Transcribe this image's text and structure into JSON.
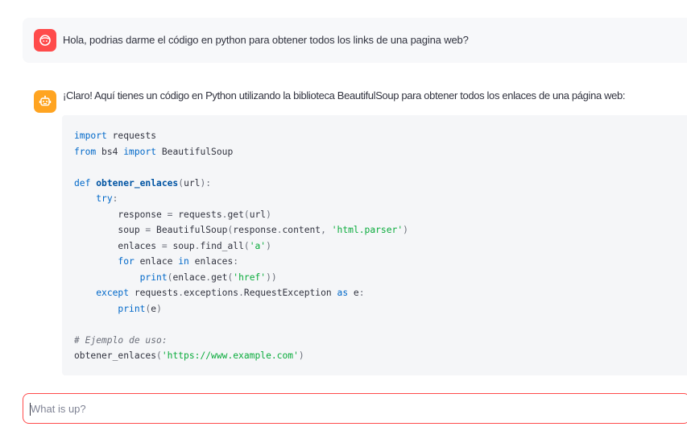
{
  "messages": [
    {
      "role": "user",
      "avatar_icon": "user-face-icon",
      "avatar_color": "#ff4b4b",
      "text": "Hola, podrias darme el código en python para obtener todos los links de una pagina web?"
    },
    {
      "role": "assistant",
      "avatar_icon": "robot-icon",
      "avatar_color": "#ffa421",
      "text": "¡Claro! Aquí tienes un código en Python utilizando la biblioteca BeautifulSoup para obtener todos los enlaces de una página web:",
      "code": {
        "language": "python",
        "lines": [
          [
            {
              "t": "import",
              "c": "kw"
            },
            {
              "t": " requests"
            }
          ],
          [
            {
              "t": "from",
              "c": "kw"
            },
            {
              "t": " bs4 "
            },
            {
              "t": "import",
              "c": "kw"
            },
            {
              "t": " BeautifulSoup"
            }
          ],
          [],
          [
            {
              "t": "def ",
              "c": "kw"
            },
            {
              "t": "obtener_enlaces",
              "c": "fn"
            },
            {
              "t": "(",
              "c": "op"
            },
            {
              "t": "url"
            },
            {
              "t": "):",
              "c": "op"
            }
          ],
          [
            {
              "t": "    "
            },
            {
              "t": "try",
              "c": "kw"
            },
            {
              "t": ":",
              "c": "op"
            }
          ],
          [
            {
              "t": "        response "
            },
            {
              "t": "=",
              "c": "op"
            },
            {
              "t": " requests"
            },
            {
              "t": ".",
              "c": "op"
            },
            {
              "t": "get"
            },
            {
              "t": "(",
              "c": "op"
            },
            {
              "t": "url"
            },
            {
              "t": ")",
              "c": "op"
            }
          ],
          [
            {
              "t": "        soup "
            },
            {
              "t": "=",
              "c": "op"
            },
            {
              "t": " BeautifulSoup"
            },
            {
              "t": "(",
              "c": "op"
            },
            {
              "t": "response"
            },
            {
              "t": ".",
              "c": "op"
            },
            {
              "t": "content"
            },
            {
              "t": ", ",
              "c": "op"
            },
            {
              "t": "'html.parser'",
              "c": "str"
            },
            {
              "t": ")",
              "c": "op"
            }
          ],
          [
            {
              "t": "        enlaces "
            },
            {
              "t": "=",
              "c": "op"
            },
            {
              "t": " soup"
            },
            {
              "t": ".",
              "c": "op"
            },
            {
              "t": "find_all"
            },
            {
              "t": "(",
              "c": "op"
            },
            {
              "t": "'a'",
              "c": "str"
            },
            {
              "t": ")",
              "c": "op"
            }
          ],
          [
            {
              "t": "        "
            },
            {
              "t": "for",
              "c": "kw"
            },
            {
              "t": " enlace "
            },
            {
              "t": "in",
              "c": "kw"
            },
            {
              "t": " enlaces"
            },
            {
              "t": ":",
              "c": "op"
            }
          ],
          [
            {
              "t": "            "
            },
            {
              "t": "print",
              "c": "kw"
            },
            {
              "t": "(",
              "c": "op"
            },
            {
              "t": "enlace"
            },
            {
              "t": ".",
              "c": "op"
            },
            {
              "t": "get"
            },
            {
              "t": "(",
              "c": "op"
            },
            {
              "t": "'href'",
              "c": "str"
            },
            {
              "t": "))",
              "c": "op"
            }
          ],
          [
            {
              "t": "    "
            },
            {
              "t": "except",
              "c": "kw"
            },
            {
              "t": " requests"
            },
            {
              "t": ".",
              "c": "op"
            },
            {
              "t": "exceptions"
            },
            {
              "t": ".",
              "c": "op"
            },
            {
              "t": "RequestException "
            },
            {
              "t": "as",
              "c": "kw"
            },
            {
              "t": " e"
            },
            {
              "t": ":",
              "c": "op"
            }
          ],
          [
            {
              "t": "        "
            },
            {
              "t": "print",
              "c": "kw"
            },
            {
              "t": "(",
              "c": "op"
            },
            {
              "t": "e"
            },
            {
              "t": ")",
              "c": "op"
            }
          ],
          [],
          [
            {
              "t": "# Ejemplo de uso:",
              "c": "cm"
            }
          ],
          [
            {
              "t": "obtener_enlaces"
            },
            {
              "t": "(",
              "c": "op"
            },
            {
              "t": "'https://www.example.com'",
              "c": "str"
            },
            {
              "t": ")",
              "c": "op"
            }
          ]
        ]
      }
    }
  ],
  "chat_input": {
    "placeholder": "What is up?",
    "value": "",
    "border_color": "#ff4b4b"
  }
}
